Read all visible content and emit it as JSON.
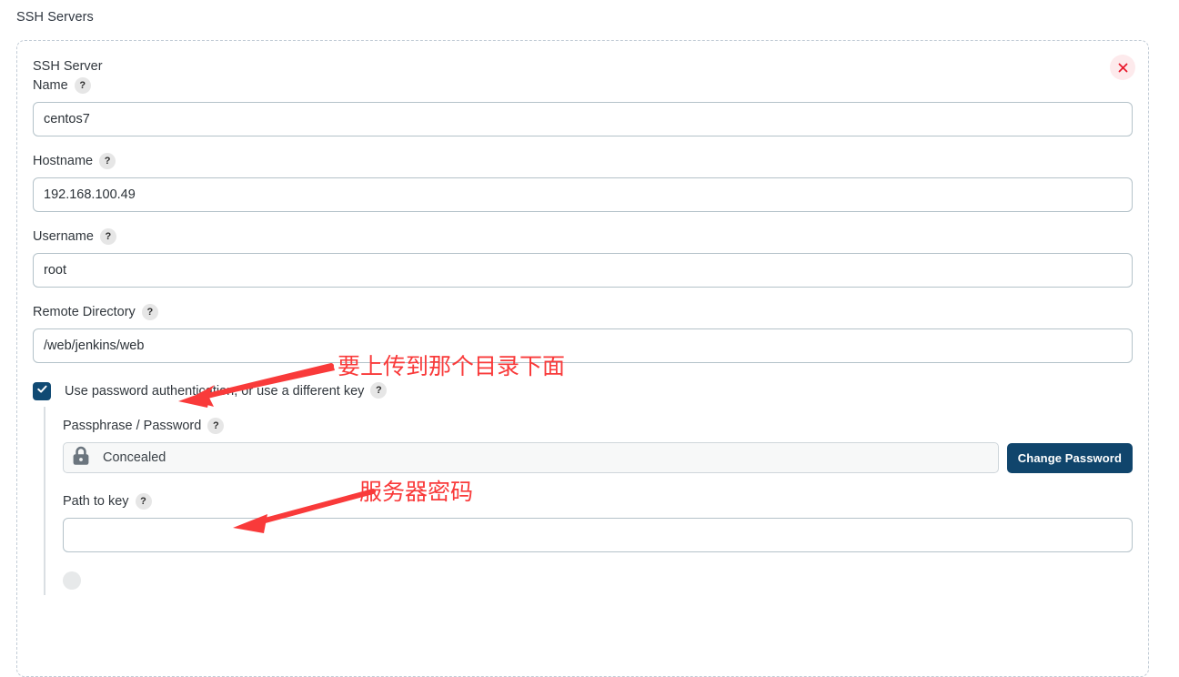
{
  "page": {
    "title": "SSH Servers"
  },
  "panel": {
    "close_icon": "close-icon",
    "fields": [
      {
        "key": "server_name",
        "label": "SSH Server Name",
        "label_line1": "SSH Server",
        "label_line2": "Name",
        "help": "?",
        "value": "centos7",
        "placeholder": ""
      },
      {
        "key": "hostname",
        "label": "Hostname",
        "help": "?",
        "value": "192.168.100.49",
        "placeholder": ""
      },
      {
        "key": "username",
        "label": "Username",
        "help": "?",
        "value": "root",
        "placeholder": ""
      },
      {
        "key": "remote_directory",
        "label": "Remote Directory",
        "help": "?",
        "value": "/web/jenkins/web",
        "placeholder": ""
      }
    ],
    "password_auth": {
      "checked": true,
      "label": "Use password authentication, or use a different key",
      "help": "?",
      "checkbox_icon": "checkmark-icon"
    },
    "passphrase": {
      "label": "Passphrase / Password",
      "help": "?",
      "lock_icon": "lock-icon",
      "value": "Concealed",
      "change_button": "Change Password"
    },
    "path_to_key": {
      "label": "Path to key",
      "help": "?",
      "value": "",
      "placeholder": ""
    }
  },
  "annotations": [
    {
      "key": "remote_dir_note",
      "text": "要上传到那个目录下面"
    },
    {
      "key": "password_note",
      "text": "服务器密码"
    }
  ],
  "colors": {
    "accent_navy": "#10456c",
    "annotation_red": "#f93a3a",
    "close_bg": "#fdeaec",
    "dashed_border": "#c2ccd6"
  }
}
